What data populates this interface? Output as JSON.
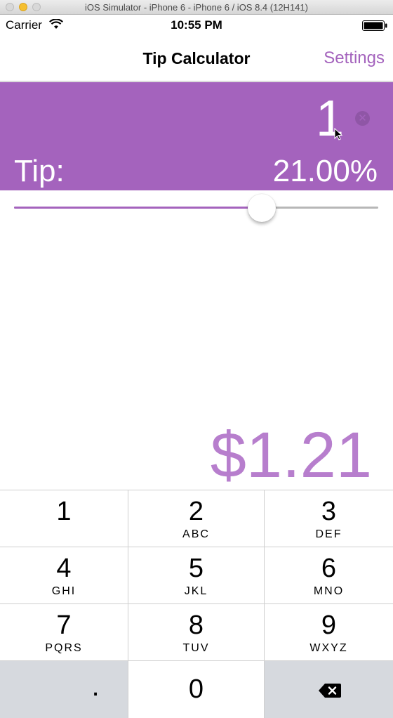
{
  "window": {
    "title": "iOS Simulator - iPhone 6 - iPhone 6 / iOS 8.4 (12H141)"
  },
  "status_bar": {
    "carrier": "Carrier",
    "time": "10:55 PM",
    "wifi_icon": "wifi-icon",
    "battery_icon": "battery-icon"
  },
  "nav": {
    "title": "Tip Calculator",
    "settings_label": "Settings"
  },
  "colors": {
    "accent": "#a463bd",
    "total": "#b77ecd",
    "keypad_gray": "#d6d9de"
  },
  "bill": {
    "value": "1",
    "clear_icon": "clear-icon"
  },
  "tip": {
    "label": "Tip:",
    "value": "21.00%"
  },
  "slider": {
    "fraction": 0.68
  },
  "total": {
    "value": "$1.21"
  },
  "keypad": {
    "keys": [
      {
        "digit": "1",
        "letters": ""
      },
      {
        "digit": "2",
        "letters": "ABC"
      },
      {
        "digit": "3",
        "letters": "DEF"
      },
      {
        "digit": "4",
        "letters": "GHI"
      },
      {
        "digit": "5",
        "letters": "JKL"
      },
      {
        "digit": "6",
        "letters": "MNO"
      },
      {
        "digit": "7",
        "letters": "PQRS"
      },
      {
        "digit": "8",
        "letters": "TUV"
      },
      {
        "digit": "9",
        "letters": "WXYZ"
      }
    ],
    "decimal": ".",
    "zero": "0",
    "delete_icon": "delete-icon"
  }
}
